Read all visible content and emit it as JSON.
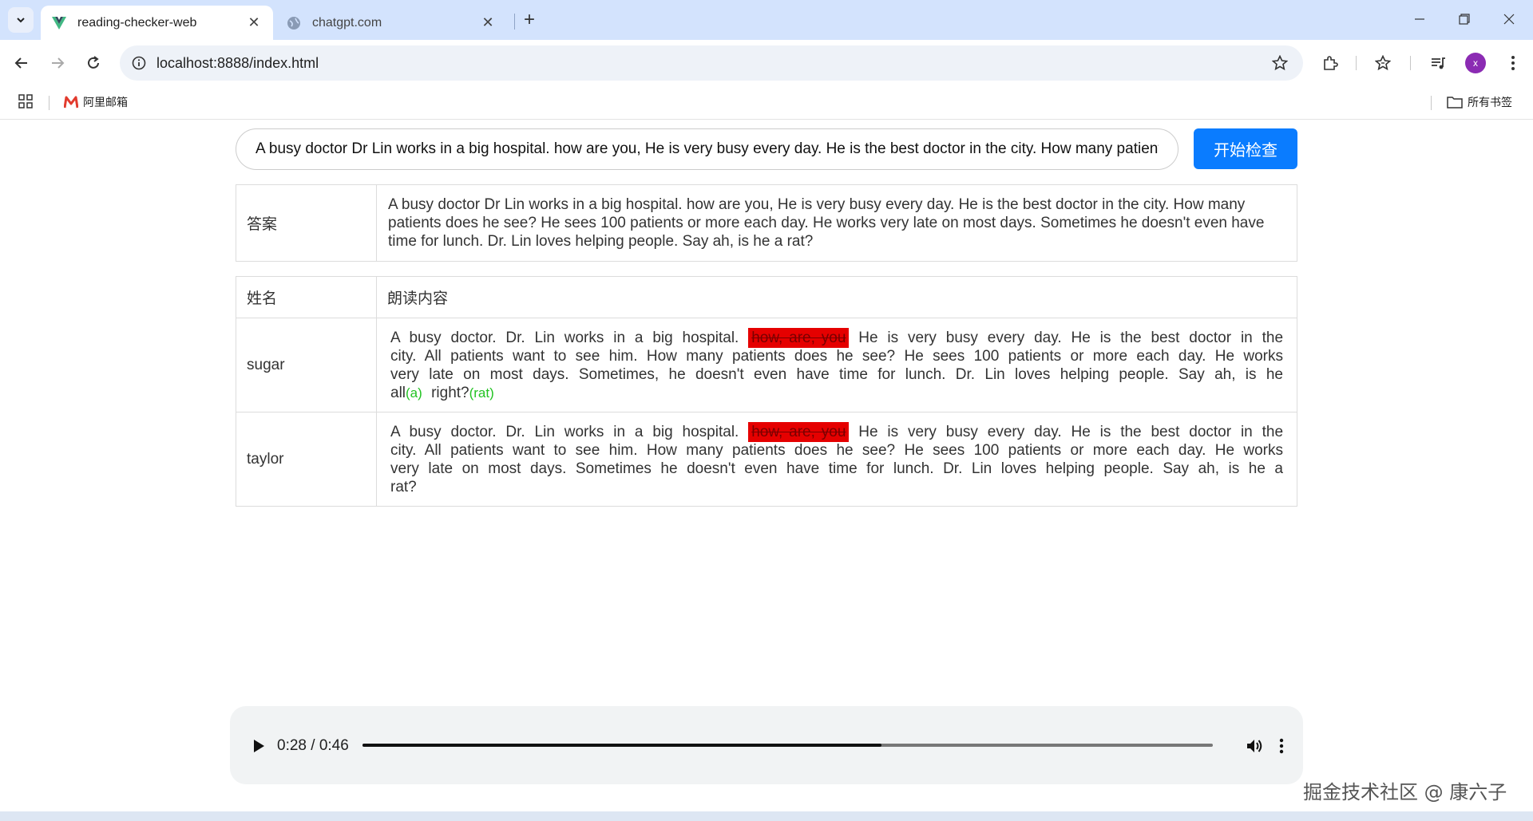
{
  "browser": {
    "tabs": [
      {
        "title": "reading-checker-web",
        "active": true
      },
      {
        "title": "chatgpt.com",
        "active": false
      }
    ],
    "url": "localhost:8888/index.html",
    "avatar_letter": "x",
    "bookmarks": [
      {
        "label": "阿里邮箱",
        "icon": "mail-m-icon"
      }
    ],
    "all_bookmarks_label": "所有书签"
  },
  "page": {
    "input_value": "A busy doctor Dr Lin works in a big hospital. how are you, He is very busy every day. He is the best doctor in the city. How many patients does he see? He sees 100 patients or more each day. He works very late on most days. Sometimes he doesn't even have time for lunch. Dr. Lin loves helping people. Say ah, is he a rat?",
    "check_button": "开始检查",
    "answer_label": "答案",
    "answer_text": "A busy doctor Dr Lin works in a big hospital. how are you, He is very busy every day. He is the best doctor in the city. How many patients does he see? He sees 100 patients or more each day. He works very late on most days. Sometimes he doesn't even have time for lunch. Dr. Lin loves helping people. Say ah, is he a rat?",
    "results_header": {
      "name": "姓名",
      "content": "朗读内容"
    },
    "results": [
      {
        "name": "sugar",
        "before": "A busy doctor. Dr. Lin works in a big hospital.",
        "wrong": "how, are, you",
        "after": "He is very busy every day. He is the best doctor in the city. All patients want to see him. How many patients does he see? He sees 100 patients or more each day. He works very late on most days. Sometimes, he doesn't even have time for lunch. Dr. Lin loves helping people. Say ah, is he all",
        "extra1": "(a)",
        "middle": "right?",
        "extra2": "(rat)"
      },
      {
        "name": "taylor",
        "before": "A busy doctor. Dr. Lin works in a big hospital.",
        "wrong": "how, are, you",
        "after": "He is very busy every day. He is the best doctor in the city. All patients want to see him. How many patients does he see? He sees 100 patients or more each day. He works very late on most days. Sometimes he doesn't even have time for lunch. Dr. Lin loves helping people. Say ah, is he a rat?"
      }
    ],
    "audio": {
      "time": "0:28 / 0:46",
      "progress": 0.61
    }
  },
  "watermark": "掘金技术社区 @ 康六子"
}
